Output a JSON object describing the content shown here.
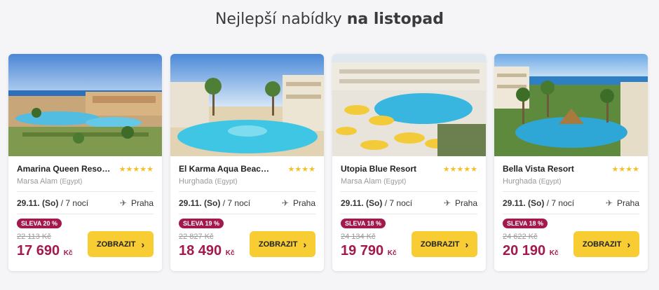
{
  "heading": {
    "normal": "Nejlepší nabídky",
    "bold": "na listopad"
  },
  "accent_color": "#a3184d",
  "button_color": "#f7cd33",
  "cards": [
    {
      "name": "Amarina Queen Resor…",
      "stars": "★★★★★",
      "location": "Marsa Alam",
      "country": "(Egypt)",
      "date": "29.11. (So)",
      "nights": "/ 7 nocí",
      "departure_icon": "plane-icon",
      "departure": "Praha",
      "discount": "SLEVA 20 %",
      "old_price": "22 113 Kč",
      "new_price": "17 690",
      "currency": "Kč",
      "button": "ZOBRAZIT"
    },
    {
      "name": "El Karma Aqua Beach Re…",
      "stars": "★★★★",
      "location": "Hurghada",
      "country": "(Egypt)",
      "date": "29.11. (So)",
      "nights": "/ 7 nocí",
      "departure_icon": "plane-icon",
      "departure": "Praha",
      "discount": "SLEVA 19 %",
      "old_price": "22 827 Kč",
      "new_price": "18 490",
      "currency": "Kč",
      "button": "ZOBRAZIT"
    },
    {
      "name": "Utopia Blue Resort",
      "stars": "★★★★★",
      "location": "Marsa Alam",
      "country": "(Egypt)",
      "date": "29.11. (So)",
      "nights": "/ 7 nocí",
      "departure_icon": "plane-icon",
      "departure": "Praha",
      "discount": "SLEVA 18 %",
      "old_price": "24 134 Kč",
      "new_price": "19 790",
      "currency": "Kč",
      "button": "ZOBRAZIT"
    },
    {
      "name": "Bella Vista Resort",
      "stars": "★★★★",
      "location": "Hurghada",
      "country": "(Egypt)",
      "date": "29.11. (So)",
      "nights": "/ 7 nocí",
      "departure_icon": "plane-icon",
      "departure": "Praha",
      "discount": "SLEVA 18 %",
      "old_price": "24 622 Kč",
      "new_price": "20 190",
      "currency": "Kč",
      "button": "ZOBRAZIT"
    }
  ]
}
